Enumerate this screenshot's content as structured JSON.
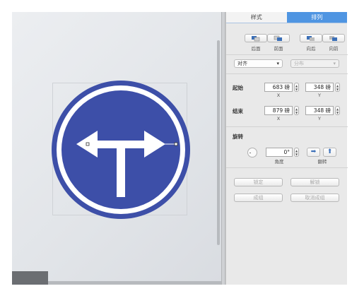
{
  "tabs": [
    {
      "label": "样式",
      "active": false
    },
    {
      "label": "排列",
      "active": true
    }
  ],
  "arrange": {
    "back_label": "后面",
    "front_label": "前面",
    "backward_label": "向后",
    "forward_label": "向前"
  },
  "align_select": "对齐",
  "distribute_select": "分布",
  "start": {
    "title": "起始",
    "x_value": "683 磅",
    "y_value": "348 磅",
    "x_label": "X",
    "y_label": "Y"
  },
  "end": {
    "title": "结束",
    "x_value": "879 磅",
    "y_value": "348 磅",
    "x_label": "X",
    "y_label": "Y"
  },
  "rotate": {
    "title": "旋转",
    "angle_value": "0°",
    "angle_label": "角度",
    "flip_label": "翻转"
  },
  "buttons": {
    "lock": "锁定",
    "unlock": "解锁",
    "group": "成组",
    "ungroup": "取消成组"
  },
  "colors": {
    "sign_blue": "#3d4fa8",
    "tab_active": "#4f95e2"
  }
}
